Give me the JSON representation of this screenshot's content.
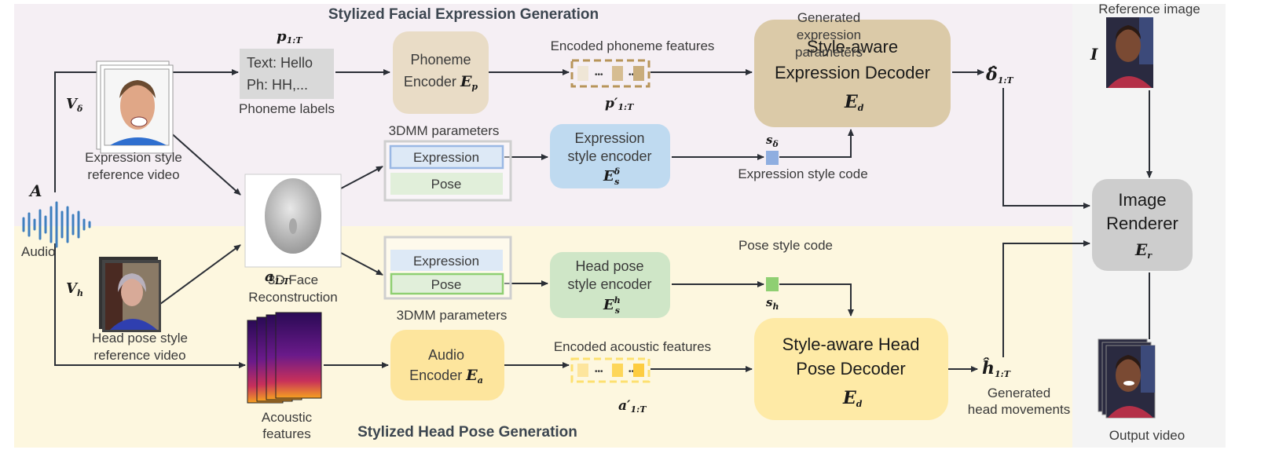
{
  "titles": {
    "top": "Stylized Facial Expression Generation",
    "bottom": "Stylized Head Pose Generation"
  },
  "colors": {
    "top_bg": "#f5eff4",
    "bottom_bg": "#fdf7df",
    "right_bg": "#f4f4f4",
    "phoneme_encoder": "#e9dcc6",
    "expression_decoder": "#dbcaa8",
    "expression_style_encoder": "#bfdaf0",
    "head_pose_style_encoder": "#cfe6c7",
    "audio_encoder": "#fde59d",
    "head_pose_decoder": "#feeaa6",
    "image_renderer": "#cdcdcd"
  },
  "audio": {
    "symbol": "A",
    "label": "Audio"
  },
  "phoneme": {
    "symbol": {
      "base": "p",
      "sub": "1:T"
    },
    "line1": "Text: Hello",
    "line2": "Ph: HH,...",
    "label": "Phoneme labels"
  },
  "phoneme_encoder": {
    "line1": "Phoneme",
    "line2": "Encoder",
    "symbol": {
      "base": "E",
      "sub": "p"
    }
  },
  "encoded_phoneme": {
    "label": "Encoded phoneme features",
    "dots": "•••",
    "symbol": {
      "base": "p′",
      "sub": "1:T"
    }
  },
  "expression_decoder": {
    "line1": "Style-aware",
    "line2": "Expression Decoder",
    "symbol": {
      "base": "E",
      "sub": "d"
    }
  },
  "generated_expression": {
    "line1": "Generated",
    "line2": "expression",
    "line3": "parameters",
    "symbol": {
      "base": "δ̂",
      "sub": "1:T"
    }
  },
  "reference_image": {
    "label": "Reference image",
    "symbol": "I"
  },
  "expr_video": {
    "symbol": {
      "base": "V",
      "sub": "δ"
    },
    "line1": "Expression style",
    "line2": "reference video"
  },
  "face_recon": {
    "line1": "3D Face",
    "line2": "Reconstruction"
  },
  "dmm_top": {
    "label": "3DMM parameters",
    "expression": "Expression",
    "pose": "Pose"
  },
  "dmm_bottom": {
    "label": "3DMM parameters",
    "expression": "Expression",
    "pose": "Pose"
  },
  "expression_style_encoder": {
    "line1": "Expression",
    "line2": "style encoder",
    "symbol": {
      "base": "E",
      "sub": "s",
      "sup": "δ"
    }
  },
  "expression_style_code": {
    "label": "Expression style code",
    "symbol": {
      "base": "s",
      "sub": "δ"
    }
  },
  "image_renderer": {
    "line1": "Image",
    "line2": "Renderer",
    "symbol": {
      "base": "E",
      "sub": "r"
    }
  },
  "head_video": {
    "symbol": {
      "base": "V",
      "sub": "h"
    },
    "line1": "Head pose style",
    "line2": "reference video"
  },
  "head_pose_style_encoder": {
    "line1": "Head pose",
    "line2": "style encoder",
    "symbol": {
      "base": "E",
      "sub": "s",
      "sup": "h"
    }
  },
  "pose_style_code": {
    "label": "Pose style code",
    "symbol": {
      "base": "s",
      "sub": "h"
    }
  },
  "acoustic": {
    "symbol": {
      "base": "a",
      "sub": "1:T"
    },
    "line1": "Acoustic",
    "line2": "features"
  },
  "audio_encoder": {
    "line1": "Audio",
    "line2": "Encoder",
    "symbol": {
      "base": "E",
      "sub": "a"
    }
  },
  "encoded_acoustic": {
    "label": "Encoded acoustic features",
    "dots": "•••",
    "symbol": {
      "base": "a′",
      "sub": "1:T"
    }
  },
  "head_pose_decoder": {
    "line1": "Style-aware Head",
    "line2": "Pose Decoder",
    "symbol": {
      "base": "E",
      "sub": "d"
    }
  },
  "generated_head": {
    "symbol": {
      "base": "ĥ",
      "sub": "1:T"
    },
    "line1": "Generated",
    "line2": "head movements"
  },
  "output_video": {
    "label": "Output video"
  }
}
